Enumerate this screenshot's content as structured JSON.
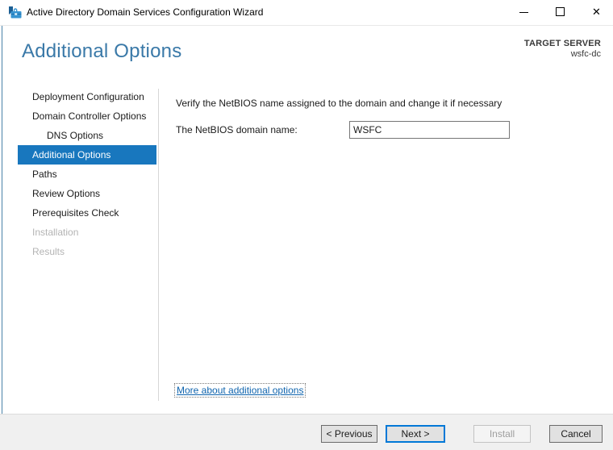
{
  "window": {
    "title": "Active Directory Domain Services Configuration Wizard",
    "icon_name": "wizard-toolbox-icon",
    "controls": {
      "close_glyph": "✕"
    }
  },
  "header": {
    "title": "Additional Options",
    "target_server_label": "TARGET SERVER",
    "target_server_name": "wsfc-dc"
  },
  "sidebar": {
    "items": [
      {
        "label": "Deployment Configuration",
        "state": "enabled"
      },
      {
        "label": "Domain Controller Options",
        "state": "enabled"
      },
      {
        "label": "DNS Options",
        "state": "enabled",
        "indent": true
      },
      {
        "label": "Additional Options",
        "state": "selected"
      },
      {
        "label": "Paths",
        "state": "enabled"
      },
      {
        "label": "Review Options",
        "state": "enabled"
      },
      {
        "label": "Prerequisites Check",
        "state": "enabled"
      },
      {
        "label": "Installation",
        "state": "disabled"
      },
      {
        "label": "Results",
        "state": "disabled"
      }
    ]
  },
  "main": {
    "instruction": "Verify the NetBIOS name assigned to the domain and change it if necessary",
    "netbios_field": {
      "label": "The NetBIOS domain name:",
      "value": "WSFC"
    },
    "more_link": "More about additional options"
  },
  "footer": {
    "buttons": [
      {
        "label": "< Previous",
        "enabled": true,
        "default": false
      },
      {
        "label": "Next >",
        "enabled": true,
        "default": true
      },
      {
        "label": "Install",
        "enabled": false,
        "default": false
      },
      {
        "label": "Cancel",
        "enabled": true,
        "default": false
      }
    ]
  },
  "colors": {
    "selected_nav_bg": "#1877be",
    "heading_blue": "#3a79a8",
    "link_blue": "#0f64ae",
    "default_button_border": "#0078d7",
    "footer_bg": "#f0f0f0"
  }
}
